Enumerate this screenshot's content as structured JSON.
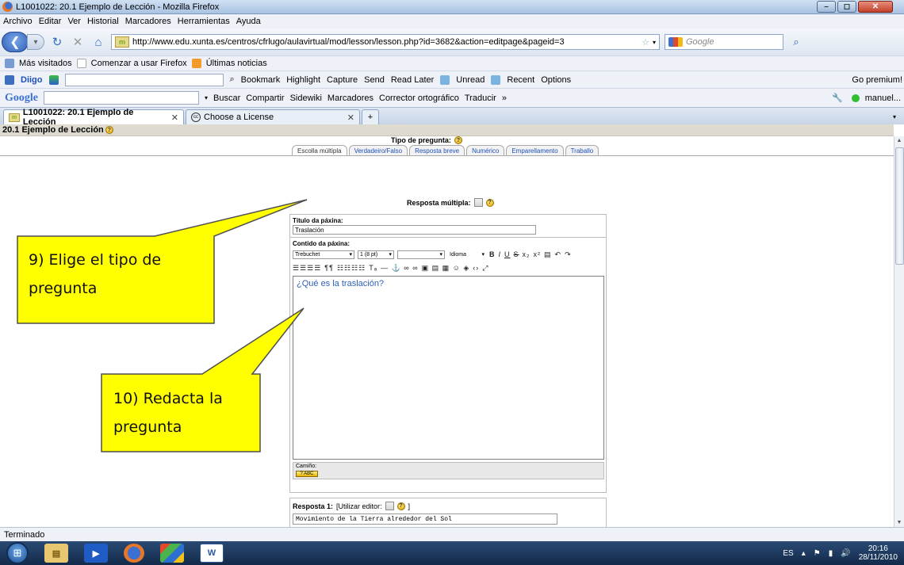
{
  "window": {
    "title": "L1001022: 20.1 Ejemplo de Lección - Mozilla Firefox"
  },
  "menu": [
    "Archivo",
    "Editar",
    "Ver",
    "Historial",
    "Marcadores",
    "Herramientas",
    "Ayuda"
  ],
  "nav": {
    "url": "http://www.edu.xunta.es/centros/cfrlugo/aulavirtual/mod/lesson/lesson.php?id=3682&action=editpage&pageid=3",
    "search_placeholder": "Google"
  },
  "bookmarks": [
    "Más visitados",
    "Comenzar a usar Firefox",
    "Últimas noticias"
  ],
  "diigo": {
    "brand": "Diigo",
    "items": [
      "Bookmark",
      "Highlight",
      "Capture",
      "Send",
      "Read Later",
      "Unread",
      "Recent",
      "Options"
    ],
    "premium": "Go premium!"
  },
  "google_toolbar": {
    "logo": "Google",
    "items": [
      "Buscar",
      "Compartir",
      "Sidewiki",
      "Marcadores",
      "Corrector ortográfico",
      "Traducir",
      "»"
    ],
    "user": "manuel..."
  },
  "tabs": [
    {
      "label": "L1001022: 20.1 Ejemplo de Lección"
    },
    {
      "label": "Choose a License"
    }
  ],
  "page": {
    "header": "20.1 Ejemplo de Lección",
    "question_type_label": "Tipo de pregunta:",
    "question_tabs": [
      "Escolla múltipla",
      "Verdadeiro/Falso",
      "Resposta breve",
      "Numérico",
      "Emparellamento",
      "Traballo"
    ],
    "multiple_answer_label": "Resposta múltipla:",
    "title_label": "Título da páxina:",
    "title_value": "Traslación",
    "content_label": "Contido da páxina:",
    "font_family": "Trebuchet",
    "font_size": "1 (8 pt)",
    "language": "Idioma",
    "editor_text": "¿Qué es la traslación?",
    "path_label": "Camiño:",
    "answer1_label": "Resposta 1:",
    "answer1_editor": "[Utilizar editor:",
    "answer1_editor_close": "]",
    "answer1_value": "Movimiento de la Tierra alrededor del Sol"
  },
  "callouts": [
    {
      "line1": "9) Elige el tipo de",
      "line2": "pregunta"
    },
    {
      "line1": "10) Redacta la",
      "line2": "pregunta"
    }
  ],
  "status": "Terminado",
  "tray": {
    "lang": "ES",
    "time": "20:16",
    "date": "28/11/2010"
  }
}
